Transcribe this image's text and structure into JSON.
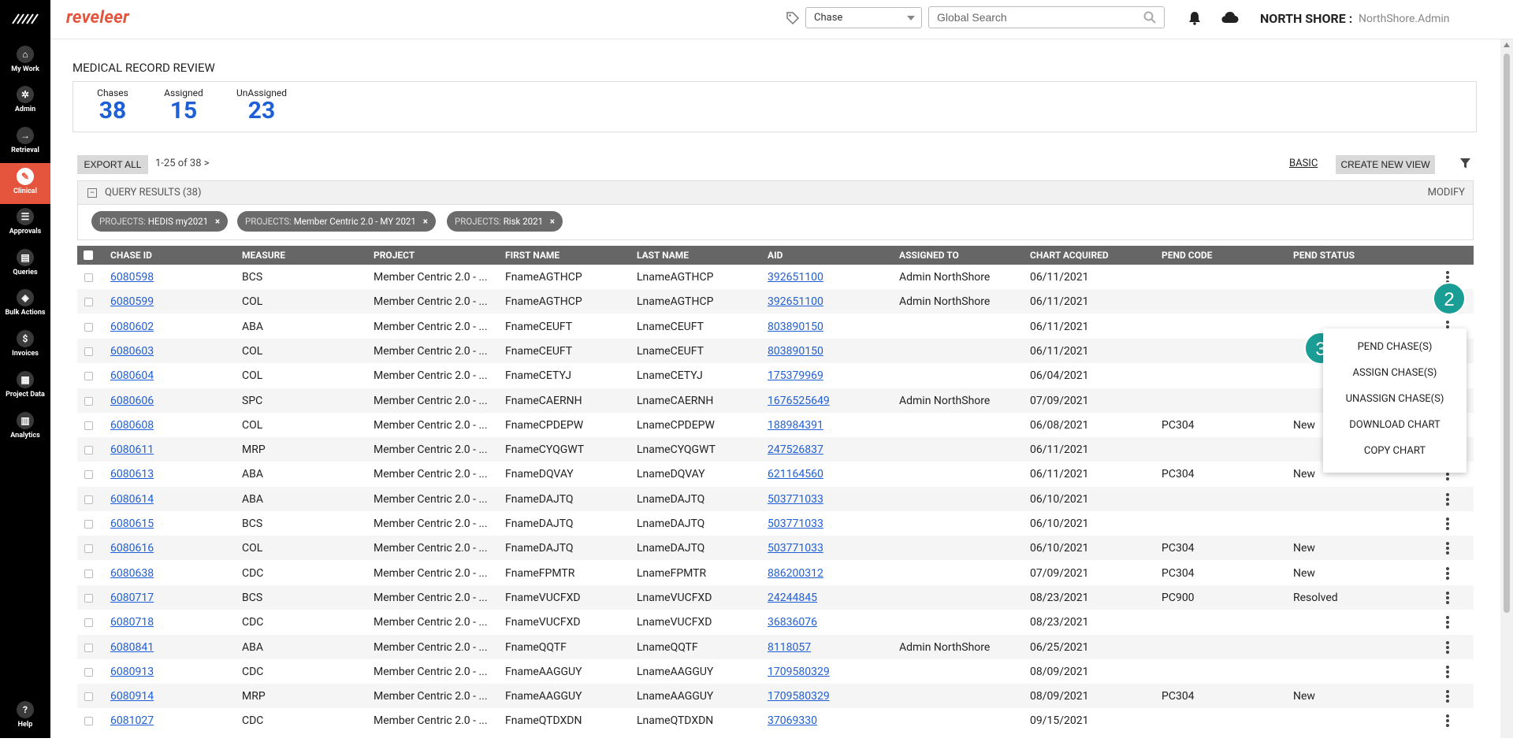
{
  "sidebar": {
    "items": [
      {
        "label": "My Work",
        "icon": "home-icon",
        "glyph": "⌂"
      },
      {
        "label": "Admin",
        "icon": "gear-icon",
        "glyph": "✲"
      },
      {
        "label": "Retrieval",
        "icon": "arrow-right-icon",
        "glyph": "→"
      },
      {
        "label": "Clinical",
        "icon": "clipboard-icon",
        "glyph": "✎"
      },
      {
        "label": "Approvals",
        "icon": "list-icon",
        "glyph": "☰"
      },
      {
        "label": "Queries",
        "icon": "document-icon",
        "glyph": "▤"
      },
      {
        "label": "Bulk Actions",
        "icon": "layers-icon",
        "glyph": "◈"
      },
      {
        "label": "Invoices",
        "icon": "dollar-icon",
        "glyph": "$"
      },
      {
        "label": "Project Data",
        "icon": "grid-icon",
        "glyph": "▦"
      },
      {
        "label": "Analytics",
        "icon": "bar-chart-icon",
        "glyph": "▥"
      }
    ],
    "help": {
      "label": "Help",
      "glyph": "?"
    }
  },
  "header": {
    "brand": "reveleer",
    "chase_select": "Chase",
    "search_placeholder": "Global Search",
    "org": "NORTH SHORE :",
    "user": "NorthShore.Admin"
  },
  "page": {
    "title": "MEDICAL RECORD REVIEW"
  },
  "stats": [
    {
      "label": "Chases",
      "value": "38"
    },
    {
      "label": "Assigned",
      "value": "15"
    },
    {
      "label": "UnAssigned",
      "value": "23"
    }
  ],
  "toolbar": {
    "export_label": "EXPORT ALL",
    "pager": "1-25  of  38 >",
    "basic_label": "BASIC",
    "create_view_label": "CREATE NEW VIEW"
  },
  "query": {
    "title": "QUERY RESULTS (38)",
    "modify": "MODIFY",
    "chips": [
      {
        "key": "PROJECTS:",
        "value": "HEDIS my2021"
      },
      {
        "key": "PROJECTS:",
        "value": "Member Centric 2.0 - MY 2021"
      },
      {
        "key": "PROJECTS:",
        "value": "Risk 2021"
      }
    ]
  },
  "table": {
    "columns": [
      "CHASE ID",
      "MEASURE",
      "PROJECT",
      "FIRST NAME",
      "LAST NAME",
      "AID",
      "ASSIGNED TO",
      "CHART ACQUIRED",
      "PEND CODE",
      "PEND STATUS"
    ],
    "rows": [
      [
        "6080598",
        "BCS",
        "Member Centric 2.0 - ...",
        "FnameAGTHCP",
        "LnameAGTHCP",
        "392651100",
        "Admin NorthShore",
        "06/11/2021",
        "",
        ""
      ],
      [
        "6080599",
        "COL",
        "Member Centric 2.0 - ...",
        "FnameAGTHCP",
        "LnameAGTHCP",
        "392651100",
        "Admin NorthShore",
        "06/11/2021",
        "",
        ""
      ],
      [
        "6080602",
        "ABA",
        "Member Centric 2.0 - ...",
        "FnameCEUFT",
        "LnameCEUFT",
        "803890150",
        "",
        "06/11/2021",
        "",
        ""
      ],
      [
        "6080603",
        "COL",
        "Member Centric 2.0 - ...",
        "FnameCEUFT",
        "LnameCEUFT",
        "803890150",
        "",
        "06/11/2021",
        "",
        ""
      ],
      [
        "6080604",
        "COL",
        "Member Centric 2.0 - ...",
        "FnameCETYJ",
        "LnameCETYJ",
        "175379969",
        "",
        "06/04/2021",
        "",
        ""
      ],
      [
        "6080606",
        "SPC",
        "Member Centric 2.0 - ...",
        "FnameCAERNH",
        "LnameCAERNH",
        "1676525649",
        "Admin NorthShore",
        "07/09/2021",
        "",
        ""
      ],
      [
        "6080608",
        "COL",
        "Member Centric 2.0 - ...",
        "FnameCPDEPW",
        "LnameCPDEPW",
        "188984391",
        "",
        "06/08/2021",
        "PC304",
        "New"
      ],
      [
        "6080611",
        "MRP",
        "Member Centric 2.0 - ...",
        "FnameCYQGWT",
        "LnameCYQGWT",
        "247526837",
        "",
        "06/11/2021",
        "",
        ""
      ],
      [
        "6080613",
        "ABA",
        "Member Centric 2.0 - ...",
        "FnameDQVAY",
        "LnameDQVAY",
        "621164560",
        "",
        "06/11/2021",
        "PC304",
        "New"
      ],
      [
        "6080614",
        "ABA",
        "Member Centric 2.0 - ...",
        "FnameDAJTQ",
        "LnameDAJTQ",
        "503771033",
        "",
        "06/10/2021",
        "",
        ""
      ],
      [
        "6080615",
        "BCS",
        "Member Centric 2.0 - ...",
        "FnameDAJTQ",
        "LnameDAJTQ",
        "503771033",
        "",
        "06/10/2021",
        "",
        ""
      ],
      [
        "6080616",
        "COL",
        "Member Centric 2.0 - ...",
        "FnameDAJTQ",
        "LnameDAJTQ",
        "503771033",
        "",
        "06/10/2021",
        "PC304",
        "New"
      ],
      [
        "6080638",
        "CDC",
        "Member Centric 2.0 - ...",
        "FnameFPMTR",
        "LnameFPMTR",
        "886200312",
        "",
        "07/09/2021",
        "PC304",
        "New"
      ],
      [
        "6080717",
        "BCS",
        "Member Centric 2.0 - ...",
        "FnameVUCFXD",
        "LnameVUCFXD",
        "24244845",
        "",
        "08/23/2021",
        "PC900",
        "Resolved"
      ],
      [
        "6080718",
        "CDC",
        "Member Centric 2.0 - ...",
        "FnameVUCFXD",
        "LnameVUCFXD",
        "36836076",
        "",
        "08/23/2021",
        "",
        ""
      ],
      [
        "6080841",
        "ABA",
        "Member Centric 2.0 - ...",
        "FnameQQTF",
        "LnameQQTF",
        "8118057",
        "Admin NorthShore",
        "06/25/2021",
        "",
        ""
      ],
      [
        "6080913",
        "CDC",
        "Member Centric 2.0 - ...",
        "FnameAAGGUY",
        "LnameAAGGUY",
        "1709580329",
        "",
        "08/09/2021",
        "",
        ""
      ],
      [
        "6080914",
        "MRP",
        "Member Centric 2.0 - ...",
        "FnameAAGGUY",
        "LnameAAGGUY",
        "1709580329",
        "",
        "08/09/2021",
        "PC304",
        "New"
      ],
      [
        "6081027",
        "CDC",
        "Member Centric 2.0 - ...",
        "FnameQTDXDN",
        "LnameQTDXDN",
        "37069330",
        "",
        "09/15/2021",
        "",
        ""
      ]
    ]
  },
  "row_menu": {
    "items": [
      "PEND CHASE(S)",
      "ASSIGN CHASE(S)",
      "UNASSIGN CHASE(S)",
      "DOWNLOAD CHART",
      "COPY CHART"
    ]
  },
  "callouts": [
    "2",
    "3"
  ],
  "colors": {
    "brand": "#e5553d",
    "link": "#1f5fd6",
    "badge": "#1a9d95",
    "header_bg": "#666666"
  }
}
